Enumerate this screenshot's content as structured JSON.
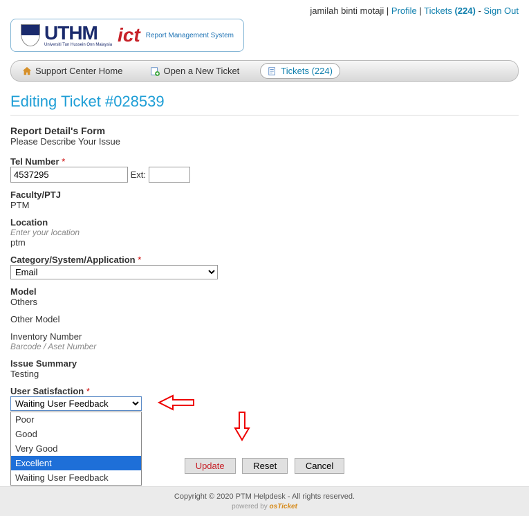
{
  "topbar": {
    "username": "jamilah binti motaji",
    "profile_label": "Profile",
    "tickets_label": "Tickets",
    "tickets_count": "(224)",
    "signout_label": "Sign Out"
  },
  "logo": {
    "uthm": "UTHM",
    "uthm_sub": "Universiti Tun Hussein Onn Malaysia",
    "ict": "ict",
    "ict_sub": "Report Management System"
  },
  "nav": {
    "support_home": "Support Center Home",
    "open_ticket": "Open a New Ticket",
    "tickets": "Tickets (224)"
  },
  "page_title": "Editing Ticket #028539",
  "form": {
    "section_title": "Report Detail's Form",
    "section_sub": "Please Describe Your Issue",
    "tel_label": "Tel Number",
    "tel_value": "4537295",
    "ext_label": "Ext:",
    "ext_value": "",
    "faculty_label": "Faculty/PTJ",
    "faculty_value": "PTM",
    "location_label": "Location",
    "location_hint": "Enter your location",
    "location_value": "ptm",
    "category_label": "Category/System/Application",
    "category_value": "Email",
    "model_label": "Model",
    "model_value": "Others",
    "other_model_label": "Other Model",
    "inventory_label": "Inventory Number",
    "inventory_hint": "Barcode / Aset Number",
    "issue_summary_label": "Issue Summary",
    "issue_summary_value": "Testing",
    "satisfaction_label": "User Satisfaction",
    "satisfaction_value": "Waiting User Feedback",
    "satisfaction_options": [
      "Poor",
      "Good",
      "Very Good",
      "Excellent",
      "Waiting User Feedback"
    ],
    "satisfaction_highlighted": "Excellent"
  },
  "buttons": {
    "update": "Update",
    "reset": "Reset",
    "cancel": "Cancel"
  },
  "footer": {
    "copyright": "Copyright © 2020 PTM Helpdesk - All rights reserved.",
    "powered": "powered by",
    "osticket": "osTicket"
  }
}
